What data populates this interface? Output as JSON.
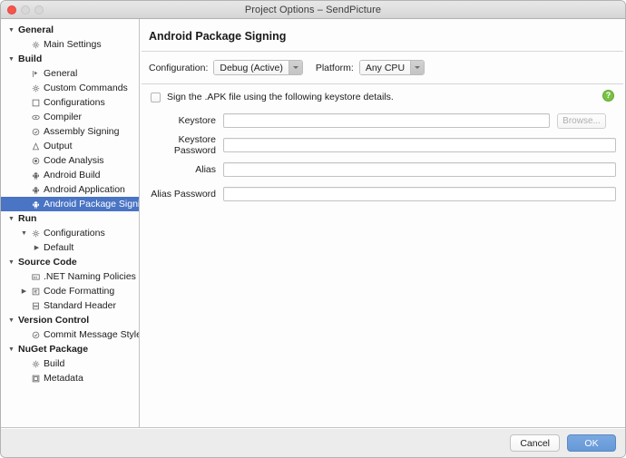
{
  "window": {
    "title": "Project Options – SendPicture",
    "traffic_lights": [
      "close-red",
      "minimize-disabled",
      "zoom-disabled"
    ]
  },
  "sidebar": {
    "items": [
      {
        "label": "General",
        "kind": "group",
        "indent": 0,
        "disclosure": "▼",
        "icon": "none",
        "selected": false
      },
      {
        "label": "Main Settings",
        "kind": "leaf",
        "indent": 1,
        "disclosure": "",
        "icon": "gear-icon",
        "selected": false
      },
      {
        "label": "Build",
        "kind": "group",
        "indent": 0,
        "disclosure": "▼",
        "icon": "none",
        "selected": false
      },
      {
        "label": "General",
        "kind": "leaf",
        "indent": 1,
        "disclosure": "",
        "icon": "play-flag-icon",
        "selected": false
      },
      {
        "label": "Custom Commands",
        "kind": "leaf",
        "indent": 1,
        "disclosure": "",
        "icon": "gear-icon",
        "selected": false
      },
      {
        "label": "Configurations",
        "kind": "leaf",
        "indent": 1,
        "disclosure": "",
        "icon": "square-icon",
        "selected": false
      },
      {
        "label": "Compiler",
        "kind": "leaf",
        "indent": 1,
        "disclosure": "",
        "icon": "compiler-icon",
        "selected": false
      },
      {
        "label": "Assembly Signing",
        "kind": "leaf",
        "indent": 1,
        "disclosure": "",
        "icon": "seal-icon",
        "selected": false
      },
      {
        "label": "Output",
        "kind": "leaf",
        "indent": 1,
        "disclosure": "",
        "icon": "triangle-icon",
        "selected": false
      },
      {
        "label": "Code Analysis",
        "kind": "leaf",
        "indent": 1,
        "disclosure": "",
        "icon": "radio-icon",
        "selected": false
      },
      {
        "label": "Android Build",
        "kind": "leaf",
        "indent": 1,
        "disclosure": "",
        "icon": "android-icon",
        "selected": false
      },
      {
        "label": "Android Application",
        "kind": "leaf",
        "indent": 1,
        "disclosure": "",
        "icon": "android-icon",
        "selected": false
      },
      {
        "label": "Android Package Signing",
        "kind": "leaf",
        "indent": 1,
        "disclosure": "",
        "icon": "android-icon",
        "selected": true
      },
      {
        "label": "Run",
        "kind": "group",
        "indent": 0,
        "disclosure": "▼",
        "icon": "none",
        "selected": false
      },
      {
        "label": "Configurations",
        "kind": "leaf",
        "indent": 1,
        "disclosure": "▼",
        "icon": "gear-icon",
        "selected": false
      },
      {
        "label": "Default",
        "kind": "leaf",
        "indent": 2,
        "disclosure": "▶",
        "icon": "none",
        "selected": false
      },
      {
        "label": "Source Code",
        "kind": "group",
        "indent": 0,
        "disclosure": "▼",
        "icon": "none",
        "selected": false
      },
      {
        "label": ".NET Naming Policies",
        "kind": "leaf",
        "indent": 1,
        "disclosure": "",
        "icon": "abc-icon",
        "selected": false
      },
      {
        "label": "Code Formatting",
        "kind": "leaf",
        "indent": 1,
        "disclosure": "▶",
        "icon": "format-icon",
        "selected": false
      },
      {
        "label": "Standard Header",
        "kind": "leaf",
        "indent": 1,
        "disclosure": "",
        "icon": "header-icon",
        "selected": false
      },
      {
        "label": "Version Control",
        "kind": "group",
        "indent": 0,
        "disclosure": "▼",
        "icon": "none",
        "selected": false
      },
      {
        "label": "Commit Message Style",
        "kind": "leaf",
        "indent": 1,
        "disclosure": "",
        "icon": "check-circle-icon",
        "selected": false
      },
      {
        "label": "NuGet Package",
        "kind": "group",
        "indent": 0,
        "disclosure": "▼",
        "icon": "none",
        "selected": false
      },
      {
        "label": "Build",
        "kind": "leaf",
        "indent": 1,
        "disclosure": "",
        "icon": "gear-icon",
        "selected": false
      },
      {
        "label": "Metadata",
        "kind": "leaf",
        "indent": 1,
        "disclosure": "",
        "icon": "metadata-icon",
        "selected": false
      }
    ]
  },
  "main": {
    "panel_title": "Android Package Signing",
    "configuration": {
      "label": "Configuration:",
      "value": "Debug (Active)"
    },
    "platform": {
      "label": "Platform:",
      "value": "Any CPU"
    },
    "sign_checkbox": {
      "label": "Sign the .APK file using the following keystore details.",
      "checked": false
    },
    "help_icon_glyph": "?",
    "fields": [
      {
        "label": "Keystore",
        "value": "",
        "placeholder": "",
        "has_browse": true,
        "browse_label": "Browse...",
        "browse_enabled": false
      },
      {
        "label": "Keystore Password",
        "value": "",
        "placeholder": "",
        "has_browse": false,
        "browse_label": "",
        "browse_enabled": false
      },
      {
        "label": "Alias",
        "value": "",
        "placeholder": "",
        "has_browse": false,
        "browse_label": "",
        "browse_enabled": false
      },
      {
        "label": "Alias Password",
        "value": "",
        "placeholder": "",
        "has_browse": false,
        "browse_label": "",
        "browse_enabled": false
      }
    ]
  },
  "footer": {
    "cancel_label": "Cancel",
    "ok_label": "OK"
  },
  "colors": {
    "selection_blue": "#4a74c4",
    "ok_button_blue": "#6699d8",
    "help_green": "#7ac143",
    "close_red": "#f6544a"
  }
}
